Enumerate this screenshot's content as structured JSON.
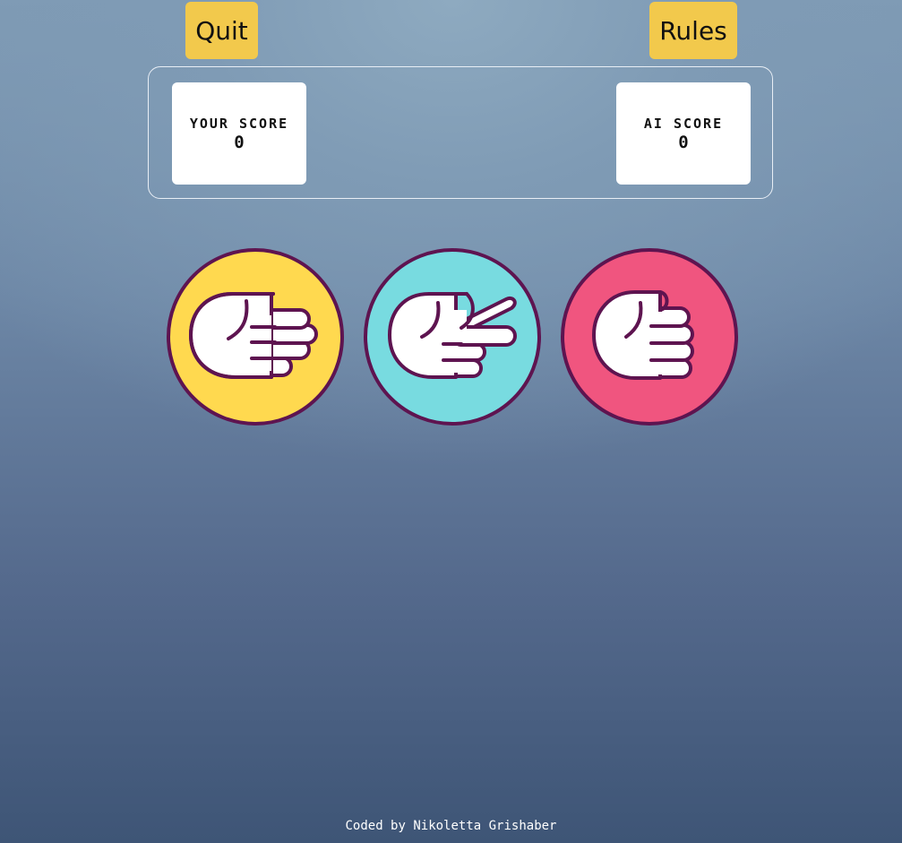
{
  "header": {
    "quit_label": "Quit",
    "rules_label": "Rules"
  },
  "scoreboard": {
    "player": {
      "label": "YOUR SCORE",
      "value": "0"
    },
    "ai": {
      "label": "AI SCORE",
      "value": "0"
    }
  },
  "choices": [
    {
      "name": "paper",
      "icon": "paper-hand-icon",
      "color": "#ffd94f"
    },
    {
      "name": "scissors",
      "icon": "scissors-hand-icon",
      "color": "#78dbe0"
    },
    {
      "name": "rock",
      "icon": "rock-fist-icon",
      "color": "#f0557f"
    }
  ],
  "colors": {
    "button": "#f2c94c",
    "outline": "#5e1450",
    "card": "#ffffff"
  },
  "footer": {
    "credit": "Coded by Nikoletta Grishaber"
  }
}
